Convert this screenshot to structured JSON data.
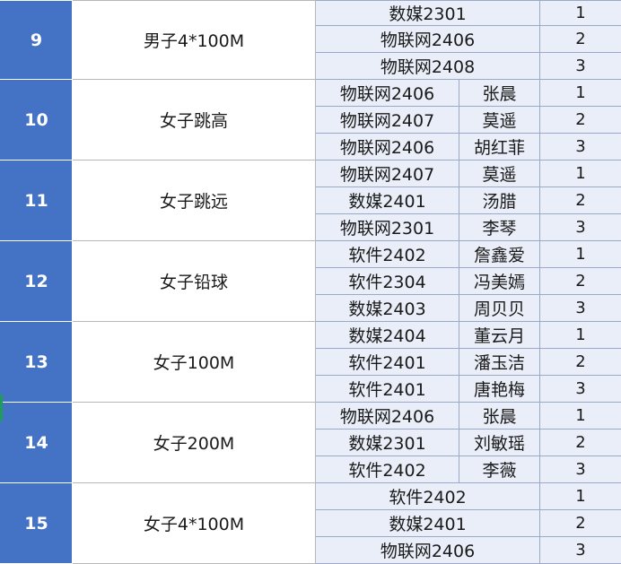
{
  "groups": [
    {
      "no": "9",
      "event": "男子4*100M",
      "rows": [
        {
          "team": "数媒2301",
          "rank": "1"
        },
        {
          "team": "物联网2406",
          "rank": "2"
        },
        {
          "team": "物联网2408",
          "rank": "3"
        }
      ]
    },
    {
      "no": "10",
      "event": "女子跳高",
      "rows": [
        {
          "class": "物联网2406",
          "name": "张晨",
          "rank": "1"
        },
        {
          "class": "物联网2407",
          "name": "莫遥",
          "rank": "2"
        },
        {
          "class": "物联网2406",
          "name": "胡红菲",
          "rank": "3"
        }
      ]
    },
    {
      "no": "11",
      "event": "女子跳远",
      "rows": [
        {
          "class": "物联网2407",
          "name": "莫遥",
          "rank": "1"
        },
        {
          "class": "数媒2401",
          "name": "汤腊",
          "rank": "2"
        },
        {
          "class": "物联网2301",
          "name": "李琴",
          "rank": "3"
        }
      ]
    },
    {
      "no": "12",
      "event": "女子铅球",
      "rows": [
        {
          "class": "软件2402",
          "name": "詹鑫爱",
          "rank": "1"
        },
        {
          "class": "软件2304",
          "name": "冯美嫣",
          "rank": "2"
        },
        {
          "class": "数媒2403",
          "name": "周贝贝",
          "rank": "3"
        }
      ]
    },
    {
      "no": "13",
      "event": "女子100M",
      "rows": [
        {
          "class": "数媒2404",
          "name": "董云月",
          "rank": "1"
        },
        {
          "class": "软件2401",
          "name": "潘玉洁",
          "rank": "2"
        },
        {
          "class": "软件2401",
          "name": "唐艳梅",
          "rank": "3"
        }
      ]
    },
    {
      "no": "14",
      "event": "女子200M",
      "rows": [
        {
          "class": "物联网2406",
          "name": "张晨",
          "rank": "1"
        },
        {
          "class": "数媒2301",
          "name": "刘敏瑶",
          "rank": "2"
        },
        {
          "class": "软件2402",
          "name": "李薇",
          "rank": "3"
        }
      ]
    },
    {
      "no": "15",
      "event": "女子4*100M",
      "rows": [
        {
          "team": "软件2402",
          "rank": "1"
        },
        {
          "team": "数媒2401",
          "rank": "2"
        },
        {
          "team": "物联网2406",
          "rank": "3"
        }
      ]
    }
  ],
  "colors": {
    "number_column": "#4472c4",
    "result_cells": "#e9eef8",
    "grid": "#b7b7b7"
  }
}
